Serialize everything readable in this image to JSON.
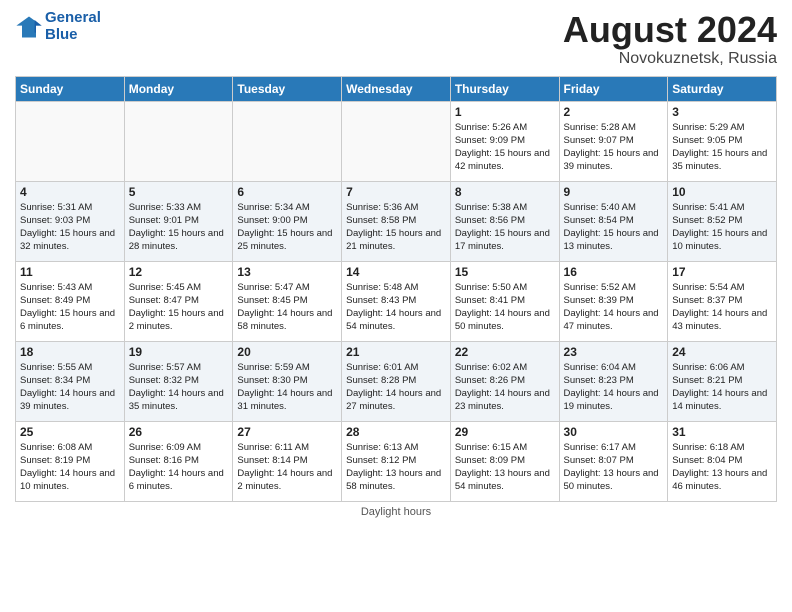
{
  "header": {
    "month_year": "August 2024",
    "location": "Novokuznetsk, Russia",
    "logo_line1": "General",
    "logo_line2": "Blue"
  },
  "days_of_week": [
    "Sunday",
    "Monday",
    "Tuesday",
    "Wednesday",
    "Thursday",
    "Friday",
    "Saturday"
  ],
  "footer": "Daylight hours",
  "weeks": [
    [
      {
        "day": "",
        "info": ""
      },
      {
        "day": "",
        "info": ""
      },
      {
        "day": "",
        "info": ""
      },
      {
        "day": "",
        "info": ""
      },
      {
        "day": "1",
        "info": "Sunrise: 5:26 AM\nSunset: 9:09 PM\nDaylight: 15 hours\nand 42 minutes."
      },
      {
        "day": "2",
        "info": "Sunrise: 5:28 AM\nSunset: 9:07 PM\nDaylight: 15 hours\nand 39 minutes."
      },
      {
        "day": "3",
        "info": "Sunrise: 5:29 AM\nSunset: 9:05 PM\nDaylight: 15 hours\nand 35 minutes."
      }
    ],
    [
      {
        "day": "4",
        "info": "Sunrise: 5:31 AM\nSunset: 9:03 PM\nDaylight: 15 hours\nand 32 minutes."
      },
      {
        "day": "5",
        "info": "Sunrise: 5:33 AM\nSunset: 9:01 PM\nDaylight: 15 hours\nand 28 minutes."
      },
      {
        "day": "6",
        "info": "Sunrise: 5:34 AM\nSunset: 9:00 PM\nDaylight: 15 hours\nand 25 minutes."
      },
      {
        "day": "7",
        "info": "Sunrise: 5:36 AM\nSunset: 8:58 PM\nDaylight: 15 hours\nand 21 minutes."
      },
      {
        "day": "8",
        "info": "Sunrise: 5:38 AM\nSunset: 8:56 PM\nDaylight: 15 hours\nand 17 minutes."
      },
      {
        "day": "9",
        "info": "Sunrise: 5:40 AM\nSunset: 8:54 PM\nDaylight: 15 hours\nand 13 minutes."
      },
      {
        "day": "10",
        "info": "Sunrise: 5:41 AM\nSunset: 8:52 PM\nDaylight: 15 hours\nand 10 minutes."
      }
    ],
    [
      {
        "day": "11",
        "info": "Sunrise: 5:43 AM\nSunset: 8:49 PM\nDaylight: 15 hours\nand 6 minutes."
      },
      {
        "day": "12",
        "info": "Sunrise: 5:45 AM\nSunset: 8:47 PM\nDaylight: 15 hours\nand 2 minutes."
      },
      {
        "day": "13",
        "info": "Sunrise: 5:47 AM\nSunset: 8:45 PM\nDaylight: 14 hours\nand 58 minutes."
      },
      {
        "day": "14",
        "info": "Sunrise: 5:48 AM\nSunset: 8:43 PM\nDaylight: 14 hours\nand 54 minutes."
      },
      {
        "day": "15",
        "info": "Sunrise: 5:50 AM\nSunset: 8:41 PM\nDaylight: 14 hours\nand 50 minutes."
      },
      {
        "day": "16",
        "info": "Sunrise: 5:52 AM\nSunset: 8:39 PM\nDaylight: 14 hours\nand 47 minutes."
      },
      {
        "day": "17",
        "info": "Sunrise: 5:54 AM\nSunset: 8:37 PM\nDaylight: 14 hours\nand 43 minutes."
      }
    ],
    [
      {
        "day": "18",
        "info": "Sunrise: 5:55 AM\nSunset: 8:34 PM\nDaylight: 14 hours\nand 39 minutes."
      },
      {
        "day": "19",
        "info": "Sunrise: 5:57 AM\nSunset: 8:32 PM\nDaylight: 14 hours\nand 35 minutes."
      },
      {
        "day": "20",
        "info": "Sunrise: 5:59 AM\nSunset: 8:30 PM\nDaylight: 14 hours\nand 31 minutes."
      },
      {
        "day": "21",
        "info": "Sunrise: 6:01 AM\nSunset: 8:28 PM\nDaylight: 14 hours\nand 27 minutes."
      },
      {
        "day": "22",
        "info": "Sunrise: 6:02 AM\nSunset: 8:26 PM\nDaylight: 14 hours\nand 23 minutes."
      },
      {
        "day": "23",
        "info": "Sunrise: 6:04 AM\nSunset: 8:23 PM\nDaylight: 14 hours\nand 19 minutes."
      },
      {
        "day": "24",
        "info": "Sunrise: 6:06 AM\nSunset: 8:21 PM\nDaylight: 14 hours\nand 14 minutes."
      }
    ],
    [
      {
        "day": "25",
        "info": "Sunrise: 6:08 AM\nSunset: 8:19 PM\nDaylight: 14 hours\nand 10 minutes."
      },
      {
        "day": "26",
        "info": "Sunrise: 6:09 AM\nSunset: 8:16 PM\nDaylight: 14 hours\nand 6 minutes."
      },
      {
        "day": "27",
        "info": "Sunrise: 6:11 AM\nSunset: 8:14 PM\nDaylight: 14 hours\nand 2 minutes."
      },
      {
        "day": "28",
        "info": "Sunrise: 6:13 AM\nSunset: 8:12 PM\nDaylight: 13 hours\nand 58 minutes."
      },
      {
        "day": "29",
        "info": "Sunrise: 6:15 AM\nSunset: 8:09 PM\nDaylight: 13 hours\nand 54 minutes."
      },
      {
        "day": "30",
        "info": "Sunrise: 6:17 AM\nSunset: 8:07 PM\nDaylight: 13 hours\nand 50 minutes."
      },
      {
        "day": "31",
        "info": "Sunrise: 6:18 AM\nSunset: 8:04 PM\nDaylight: 13 hours\nand 46 minutes."
      }
    ]
  ]
}
